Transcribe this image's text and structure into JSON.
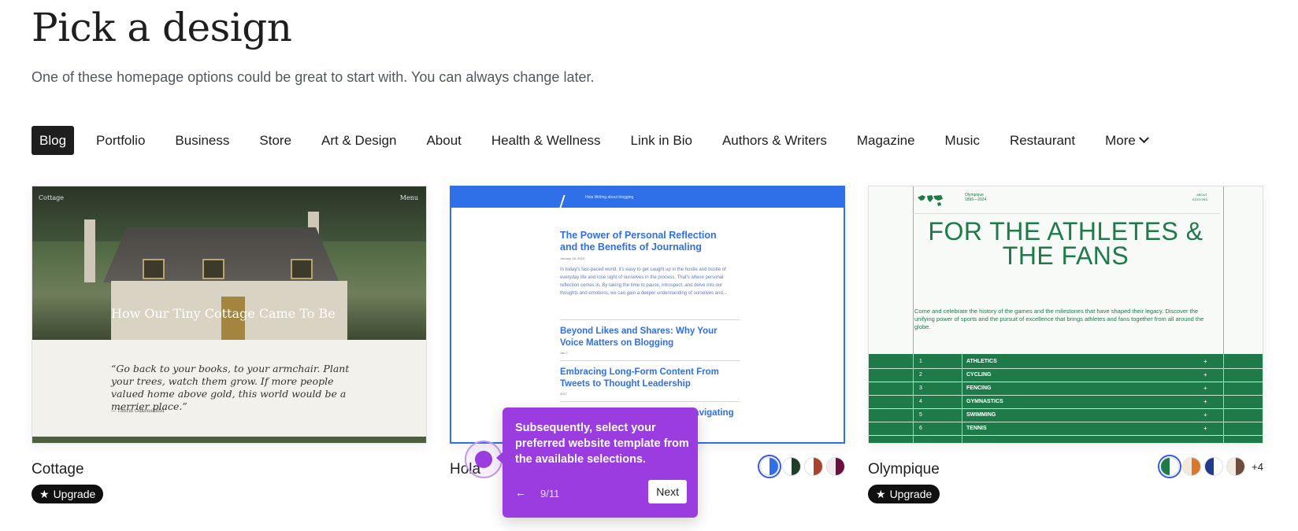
{
  "header": {
    "title": "Pick a design",
    "subtitle": "One of these homepage options could be great to start with. You can always change later."
  },
  "categories": [
    {
      "label": "Blog",
      "active": true
    },
    {
      "label": "Portfolio",
      "active": false
    },
    {
      "label": "Business",
      "active": false
    },
    {
      "label": "Store",
      "active": false
    },
    {
      "label": "Art & Design",
      "active": false
    },
    {
      "label": "About",
      "active": false
    },
    {
      "label": "Health & Wellness",
      "active": false
    },
    {
      "label": "Link in Bio",
      "active": false
    },
    {
      "label": "Authors & Writers",
      "active": false
    },
    {
      "label": "Magazine",
      "active": false
    },
    {
      "label": "Music",
      "active": false
    },
    {
      "label": "Restaurant",
      "active": false
    },
    {
      "label": "More",
      "active": false
    }
  ],
  "designs": [
    {
      "name": "Cottage",
      "badge": "Upgrade",
      "preview": {
        "brand": "Cottage",
        "menu": "Menu",
        "hero_title": "How Our Tiny Cottage Came To Be",
        "quote": "“Go back to your books, to your armchair. Plant your trees, watch them grow. If more people valued home above gold, this world would be a merrier place.”",
        "cite": "— Thorin Oakenshield"
      }
    },
    {
      "name": "Hola",
      "preview": {
        "site": "Hola   Writing about blogging",
        "posts": [
          "The Power of Personal Reflection and the Benefits of Journaling",
          "Beyond Likes and Shares: Why Your Voice Matters on Blogging",
          "Embracing Long-Form Content From Tweets to Thought Leadership",
          "Finding Your Niche and Tribe Navigating"
        ],
        "dates": [
          "January 18, 2024",
          "Jan 7",
          "2017"
        ],
        "excerpt": "In today's fast-paced world, it's easy to get caught up in the hustle and bustle of everyday life and lose sight of ourselves in the process. That's where personal reflection comes in. By taking the time to pause, introspect, and delve into our thoughts and emotions, we can gain a deeper understanding of ourselves and..."
      },
      "swatches": [
        {
          "left": "#ffffff",
          "right": "#2f6fe8"
        },
        {
          "left": "#ffffff",
          "right": "#1f3d2b"
        },
        {
          "left": "#ffffff",
          "right": "#a8442c"
        },
        {
          "left": "#f5e9f0",
          "right": "#6b0f3f"
        }
      ]
    },
    {
      "name": "Olympique",
      "badge": "Upgrade",
      "preview": {
        "years": "Olympique\n1896—2024",
        "about": "ABOUT\nEDITIONS",
        "headline": "FOR THE ATHLETES & THE FANS",
        "text": "Come and celebrate the history of the games and the milestones that have shaped their legacy. Discover the unifying power of sports and the pursuit of excellence that brings athletes and fans together from all around the globe.",
        "rows": [
          {
            "n": "1",
            "label": "ATHLETICS"
          },
          {
            "n": "2",
            "label": "CYCLING"
          },
          {
            "n": "3",
            "label": "FENCING"
          },
          {
            "n": "4",
            "label": "GYMNASTICS"
          },
          {
            "n": "5",
            "label": "SWIMMING"
          },
          {
            "n": "6",
            "label": "TENNIS"
          }
        ]
      },
      "swatches": [
        {
          "left": "#1f7a4a",
          "right": "#ffffff"
        },
        {
          "left": "#f1e9dc",
          "right": "#d9782d"
        },
        {
          "left": "#223a8a",
          "right": "#ffffff"
        },
        {
          "left": "#f1ebe3",
          "right": "#6e4e3a"
        }
      ],
      "more_swatches": "+4"
    }
  ],
  "tour": {
    "text": "Subsequently, select your preferred website template from the available selections.",
    "step": "9/11",
    "next_label": "Next",
    "back_icon": "arrow-left-icon"
  },
  "colors": {
    "accent": "#9b3ce0",
    "active_tab": "#1e1e1e",
    "hola_blue": "#2f6fe8",
    "olympique_green": "#1f7a4a"
  }
}
